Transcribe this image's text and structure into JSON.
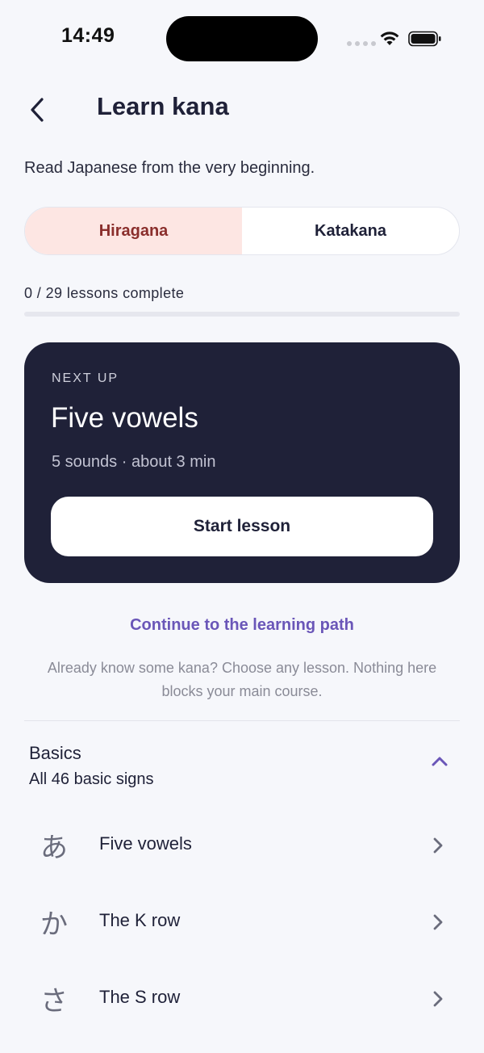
{
  "status": {
    "time": "14:49"
  },
  "header": {
    "title": "Learn kana",
    "subtitle": "Read Japanese from the very beginning."
  },
  "tabs": [
    {
      "label": "Hiragana",
      "active": true
    },
    {
      "label": "Katakana",
      "active": false
    }
  ],
  "progress": {
    "label": "0 / 29 lessons complete",
    "completed": 0,
    "total": 29
  },
  "next_up": {
    "eyebrow": "NEXT UP",
    "title": "Five vowels",
    "meta": "5 sounds · about 3 min",
    "button_label": "Start lesson"
  },
  "continue_link": "Continue to the learning path",
  "helper_text": "Already know some kana? Choose any lesson. Nothing here blocks your main course.",
  "section": {
    "title": "Basics",
    "subtitle": "All 46 basic signs",
    "expanded": true
  },
  "lessons": [
    {
      "kana": "あ",
      "label": "Five vowels"
    },
    {
      "kana": "か",
      "label": "The K row"
    },
    {
      "kana": "さ",
      "label": "The S row"
    }
  ],
  "colors": {
    "background": "#f6f7fb",
    "card": "#1f2138",
    "accent": "#6a56b8",
    "active_tab_bg": "#fde6e3",
    "active_tab_text": "#8a2e2c"
  },
  "icons": {
    "back": "chevron-left-icon",
    "collapse": "chevron-up-icon",
    "row": "chevron-right-icon",
    "wifi": "wifi-icon",
    "battery": "battery-icon",
    "signal": "cellular-signal-icon"
  }
}
